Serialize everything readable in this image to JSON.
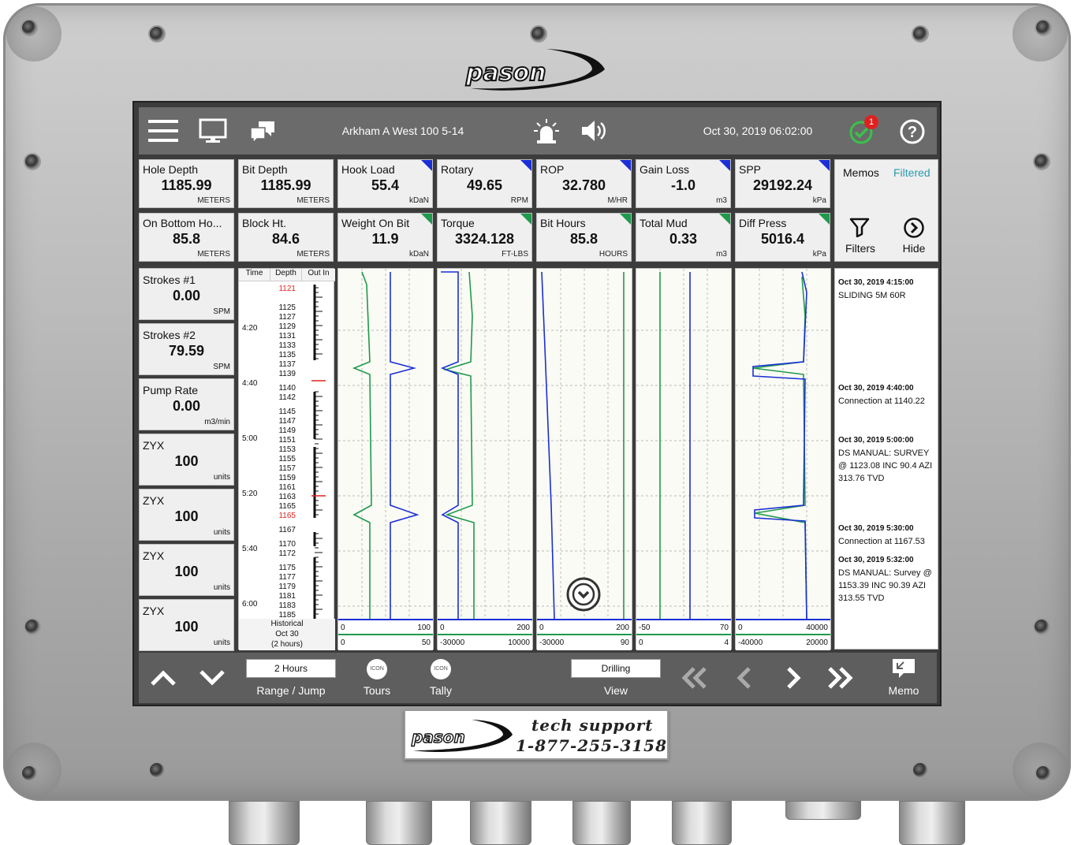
{
  "brand": {
    "logo": "pason",
    "support_line1": "tech support",
    "support_line2": "1-877-255-3158"
  },
  "topbar": {
    "well_name": "Arkham A West 100 5-14",
    "datetime": "Oct 30, 2019 06:02:00",
    "alarm_count": "1"
  },
  "tiles": [
    {
      "label": "Hole Depth",
      "value": "1185.99",
      "unit": "METERS",
      "flag": ""
    },
    {
      "label": "Bit Depth",
      "value": "1185.99",
      "unit": "METERS",
      "flag": ""
    },
    {
      "label": "Hook Load",
      "value": "55.4",
      "unit": "kDaN",
      "flag": "blue"
    },
    {
      "label": "Rotary",
      "value": "49.65",
      "unit": "RPM",
      "flag": "blue"
    },
    {
      "label": "ROP",
      "value": "32.780",
      "unit": "M/HR",
      "flag": "blue"
    },
    {
      "label": "Gain Loss",
      "value": "-1.0",
      "unit": "m3",
      "flag": "blue"
    },
    {
      "label": "SPP",
      "value": "29192.24",
      "unit": "kPa",
      "flag": "blue"
    },
    {
      "label": "On Bottom Ho...",
      "value": "85.8",
      "unit": "METERS",
      "flag": ""
    },
    {
      "label": "Block Ht.",
      "value": "84.6",
      "unit": "METERS",
      "flag": ""
    },
    {
      "label": "Weight On Bit",
      "value": "11.9",
      "unit": "kDaN",
      "flag": "green"
    },
    {
      "label": "Torque",
      "value": "3324.128",
      "unit": "FT-LBS",
      "flag": "green"
    },
    {
      "label": "Bit Hours",
      "value": "85.8",
      "unit": "HOURS",
      "flag": "green"
    },
    {
      "label": "Total Mud",
      "value": "0.33",
      "unit": "m3",
      "flag": "green"
    },
    {
      "label": "Diff Press",
      "value": "5016.4",
      "unit": "kPa",
      "flag": "green"
    }
  ],
  "side_tiles": [
    {
      "label": "Strokes #1",
      "value": "0.00",
      "unit": "SPM"
    },
    {
      "label": "Strokes #2",
      "value": "79.59",
      "unit": "SPM"
    },
    {
      "label": "Pump Rate",
      "value": "0.00",
      "unit": "m3/min"
    },
    {
      "label": "ZYX",
      "value": "100",
      "unit": "units"
    },
    {
      "label": "ZYX",
      "value": "100",
      "unit": "units"
    },
    {
      "label": "ZYX",
      "value": "100",
      "unit": "units"
    },
    {
      "label": "ZYX",
      "value": "100",
      "unit": "units"
    }
  ],
  "memos": {
    "title": "Memos",
    "filter_status": "Filtered",
    "filters_label": "Filters",
    "hide_label": "Hide",
    "entries": [
      {
        "time": "Oct 30, 2019 4:15:00",
        "text": "SLIDING 5M 60R"
      },
      {
        "time": "Oct 30, 2019 4:40:00",
        "text": "Connection at 1140.22"
      },
      {
        "time": "Oct 30, 2019 5:00:00",
        "text": "DS MANUAL: SURVEY @ 1123.08 INC 90.4 AZI 313.76 TVD"
      },
      {
        "time": "Oct 30, 2019 5:30:00",
        "text": "Connection at 1167.53"
      },
      {
        "time": "Oct 30, 2019 5:32:00",
        "text": "DS MANUAL: Survey @ 1153.39 INC 90.39 AZI 313.55 TVD"
      }
    ]
  },
  "track": {
    "headers": [
      "Time",
      "Depth",
      "Out In"
    ],
    "times": [
      "4:20",
      "4:40",
      "5:00",
      "5:20",
      "5:40",
      "6:00"
    ],
    "depths": [
      {
        "d": "1121",
        "red": true
      },
      {
        "d": "1125"
      },
      {
        "d": "1127"
      },
      {
        "d": "1129"
      },
      {
        "d": "1131"
      },
      {
        "d": "1133"
      },
      {
        "d": "1135"
      },
      {
        "d": "1137"
      },
      {
        "d": "1139"
      },
      {
        "d": "1140"
      },
      {
        "d": "1142"
      },
      {
        "d": "1145"
      },
      {
        "d": "1147"
      },
      {
        "d": "1149"
      },
      {
        "d": "1151"
      },
      {
        "d": "1153"
      },
      {
        "d": "1155"
      },
      {
        "d": "1157"
      },
      {
        "d": "1159"
      },
      {
        "d": "1161"
      },
      {
        "d": "1163"
      },
      {
        "d": "1165"
      },
      {
        "d": "1165",
        "red": true
      },
      {
        "d": "1167"
      },
      {
        "d": "1170"
      },
      {
        "d": "1172"
      },
      {
        "d": "1175"
      },
      {
        "d": "1177"
      },
      {
        "d": "1179"
      },
      {
        "d": "1181"
      },
      {
        "d": "1183"
      },
      {
        "d": "1185"
      }
    ],
    "historical": [
      "Historical",
      "Oct 30",
      "(2 hours)"
    ]
  },
  "charts": [
    {
      "top_min": "0",
      "top_max": "100",
      "bot_min": "0",
      "bot_max": "50"
    },
    {
      "top_min": "0",
      "top_max": "200",
      "bot_min": "-30000",
      "bot_max": "10000"
    },
    {
      "top_min": "0",
      "top_max": "200",
      "bot_min": "-30000",
      "bot_max": "90"
    },
    {
      "top_min": "-50",
      "top_max": "70",
      "bot_min": "0",
      "bot_max": "4"
    },
    {
      "top_min": "0",
      "top_max": "40000",
      "bot_min": "-40000",
      "bot_max": "20000"
    }
  ],
  "bottombar": {
    "range_value": "2 Hours",
    "range_label": "Range / Jump",
    "tours_label": "Tours",
    "tally_label": "Tally",
    "icon_text": "ICON",
    "view_value": "Drilling",
    "view_label": "View",
    "memo_label": "Memo"
  },
  "colors": {
    "blue_series": "#1a2fd6",
    "green_series": "#1e9a4c"
  }
}
